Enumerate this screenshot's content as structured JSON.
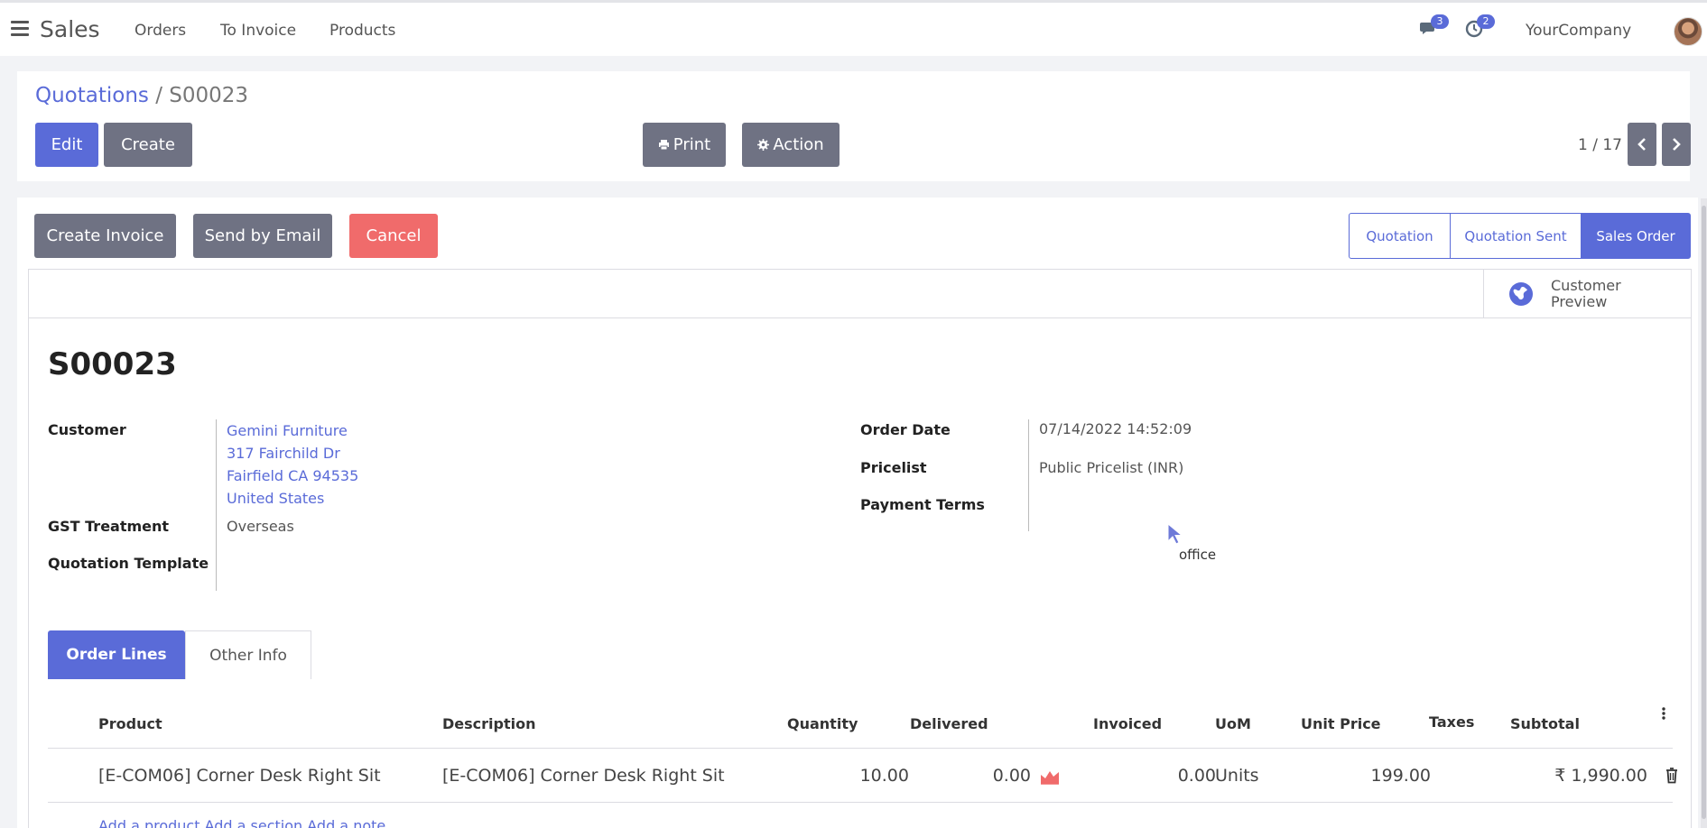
{
  "topnav": {
    "brand": "Sales",
    "menu": [
      "Orders",
      "To Invoice",
      "Products"
    ],
    "messages_count": "3",
    "activities_count": "2",
    "company": "YourCompany"
  },
  "control": {
    "breadcrumb_parent": "Quotations",
    "breadcrumb_sep": " / ",
    "breadcrumb_current": "S00023",
    "edit_label": "Edit",
    "create_label": "Create",
    "print_label": "Print",
    "action_label": "Action",
    "pager": "1 / 17"
  },
  "form": {
    "create_invoice_label": "Create Invoice",
    "send_email_label": "Send by Email",
    "cancel_label": "Cancel",
    "stages": [
      "Quotation",
      "Quotation Sent",
      "Sales Order"
    ],
    "active_stage": "Sales Order",
    "customer_preview_line1": "Customer",
    "customer_preview_line2": "Preview",
    "name": "S00023",
    "labels": {
      "customer": "Customer",
      "gst_treatment": "GST Treatment",
      "quotation_template": "Quotation Template",
      "order_date": "Order Date",
      "pricelist": "Pricelist",
      "payment_terms": "Payment Terms"
    },
    "customer_lines": [
      "Gemini Furniture",
      "317 Fairchild Dr",
      "Fairfield CA 94535",
      "United States"
    ],
    "gst_treatment": "Overseas",
    "order_date": "07/14/2022 14:52:09",
    "pricelist": "Public Pricelist (INR)",
    "cursor_tooltip": "office"
  },
  "tabs": [
    "Order Lines",
    "Other Info"
  ],
  "order_lines": {
    "columns": [
      "Product",
      "Description",
      "Quantity",
      "Delivered",
      "Invoiced",
      "UoM",
      "Unit Price",
      "Taxes",
      "Subtotal"
    ],
    "rows": [
      {
        "product": "[E-COM06] Corner Desk Right Sit",
        "description": "[E-COM06] Corner Desk Right Sit",
        "quantity": "10.00",
        "delivered": "0.00",
        "invoiced": "0.00",
        "uom": "Units",
        "unit_price": "199.00",
        "subtotal": "₹ 1,990.00"
      }
    ],
    "add_links": "Add a product    Add a section    Add a note"
  },
  "colors": {
    "accent": "#5a6bd8",
    "secondary": "#6f7283",
    "danger": "#f06b6b"
  }
}
